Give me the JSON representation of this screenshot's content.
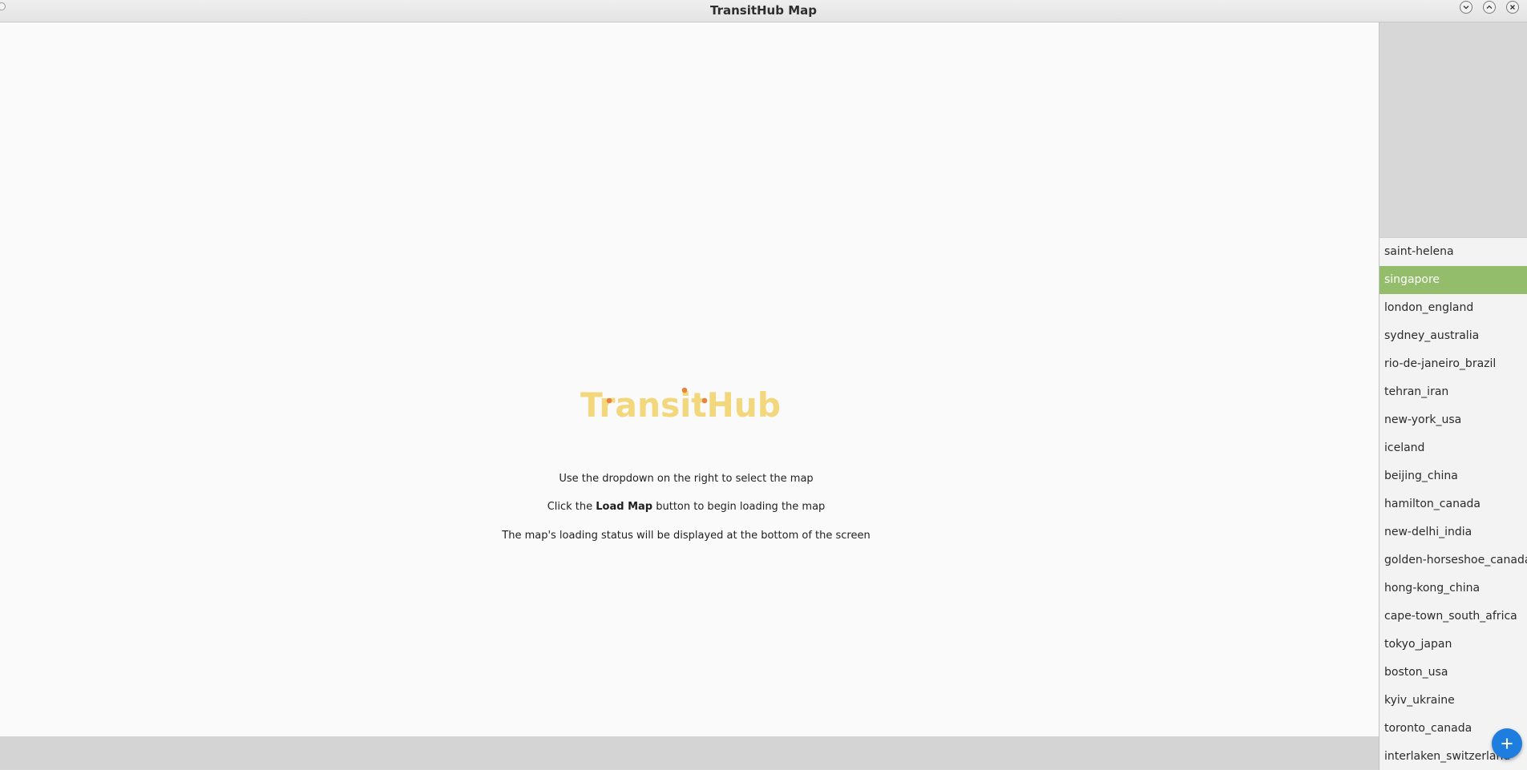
{
  "window": {
    "title": "TransitHub Map"
  },
  "logo": {
    "text": "TransitHub",
    "color": "#f2d77c",
    "dot_color": "#e8833a"
  },
  "instructions": {
    "line1": "Use the dropdown on the right to select the map",
    "line2_prefix": "Click the ",
    "line2_bold": "Load Map",
    "line2_suffix": " button to begin loading the map",
    "line3": "The map's loading status will be displayed at the bottom of the screen"
  },
  "map_dropdown": {
    "selected": "singapore",
    "selected_color": "#93bd6a",
    "items": [
      "saint-helena",
      "singapore",
      "london_england",
      "sydney_australia",
      "rio-de-janeiro_brazil",
      "tehran_iran",
      "new-york_usa",
      "iceland",
      "beijing_china",
      "hamilton_canada",
      "new-delhi_india",
      "golden-horseshoe_canada",
      "hong-kong_china",
      "cape-town_south_africa",
      "tokyo_japan",
      "boston_usa",
      "kyiv_ukraine",
      "toronto_canada",
      "interlaken_switzerland"
    ]
  },
  "fab": {
    "icon": "plus-icon",
    "color": "#1e7ee0"
  }
}
